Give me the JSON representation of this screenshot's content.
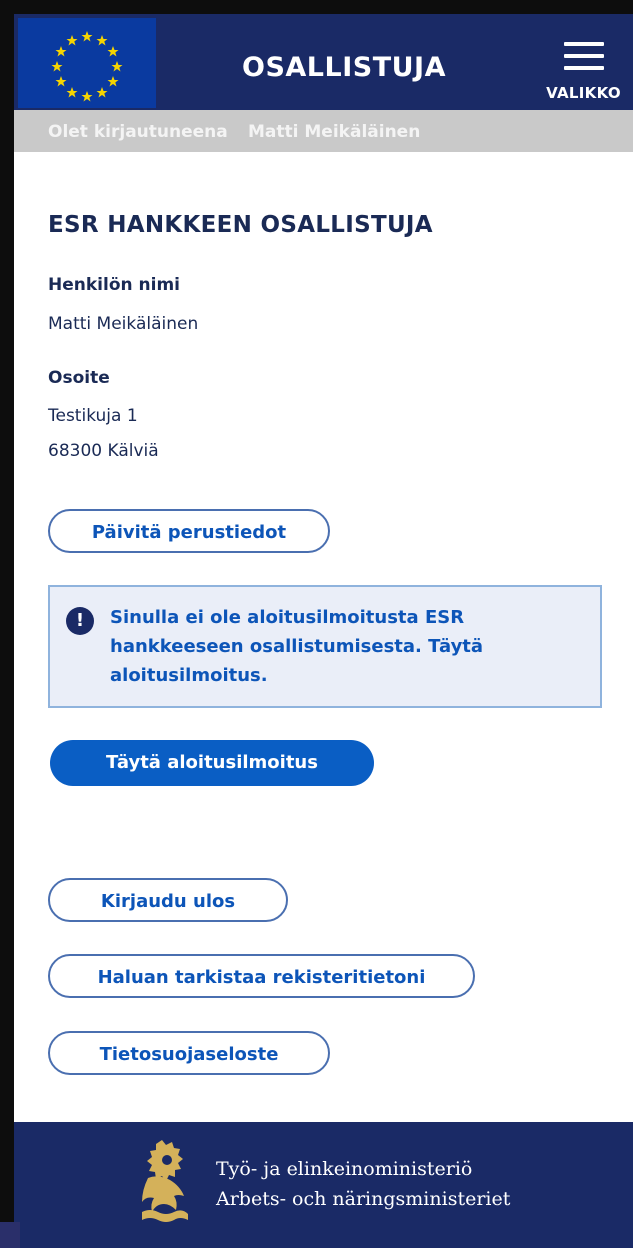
{
  "header": {
    "title": "OSALLISTUJA",
    "menu_label": "VALIKKO"
  },
  "login": {
    "prefix": "Olet kirjautuneena",
    "user_name": "Matti Meikäläinen"
  },
  "main": {
    "title": "ESR HANKKEEN OSALLISTUJA",
    "name_label": "Henkilön nimi",
    "name_value": "Matti Meikäläinen",
    "address_label": "Osoite",
    "address_line1": "Testikuja 1",
    "address_line2": "68300 Kälviä",
    "update_button": "Päivitä perustiedot",
    "notice_icon": "!",
    "notice_text": "Sinulla ei ole aloitusilmoitusta  ESR hankkeeseen osallistumisesta. Täytä aloitusilmoitus.",
    "fill_button": "Täytä aloitusilmoitus",
    "logout_button": "Kirjaudu ulos",
    "check_records_button": "Haluan tarkistaa rekisteritietoni",
    "privacy_button": "Tietosuojaseloste"
  },
  "footer": {
    "line1": "Työ- ja elinkeinoministeriö",
    "line2": "Arbets- och näringsministeriet"
  },
  "colors": {
    "header_bg": "#1a2a66",
    "eu_blue": "#0a3aa0",
    "eu_star": "#f5d400",
    "accent": "#0a5ec4",
    "notice_bg": "#eaeef8",
    "login_bar_bg": "#c9c9c9",
    "footer_gold": "#d4b15a"
  },
  "icons": {
    "eu_flag": "eu-flag-icon",
    "menu": "hamburger-menu-icon",
    "notice": "exclamation-icon",
    "footer_logo": "lion-crest-icon"
  }
}
